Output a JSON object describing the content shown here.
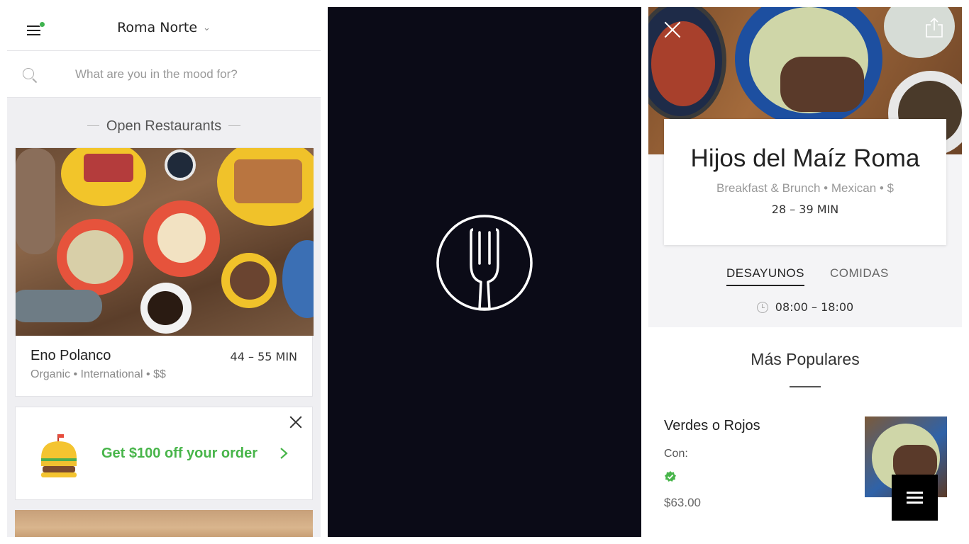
{
  "panel1": {
    "location": "Roma Norte",
    "search_placeholder": "What are you in the mood for?",
    "section_title": "Open Restaurants",
    "restaurant": {
      "name": "Eno Polanco",
      "time": "44 – 55 MIN",
      "tags": "Organic • International • $$"
    },
    "promo": {
      "text": "Get $100 off your order"
    }
  },
  "panel3": {
    "restaurant_name": "Hijos del Maíz Roma",
    "categories": "Breakfast & Brunch • Mexican • $",
    "delivery_time": "28 – 39 MIN",
    "tabs": [
      "DESAYUNOS",
      "COMIDAS"
    ],
    "hours": "08:00 – 18:00",
    "section_title": "Más Populares",
    "item": {
      "name": "Verdes o Rojos",
      "con": "Con:",
      "price": "$63.00"
    }
  },
  "colors": {
    "accent_green": "#48b54a",
    "splash_bg": "#0b0b17",
    "notification_dot": "#3fb34f"
  }
}
